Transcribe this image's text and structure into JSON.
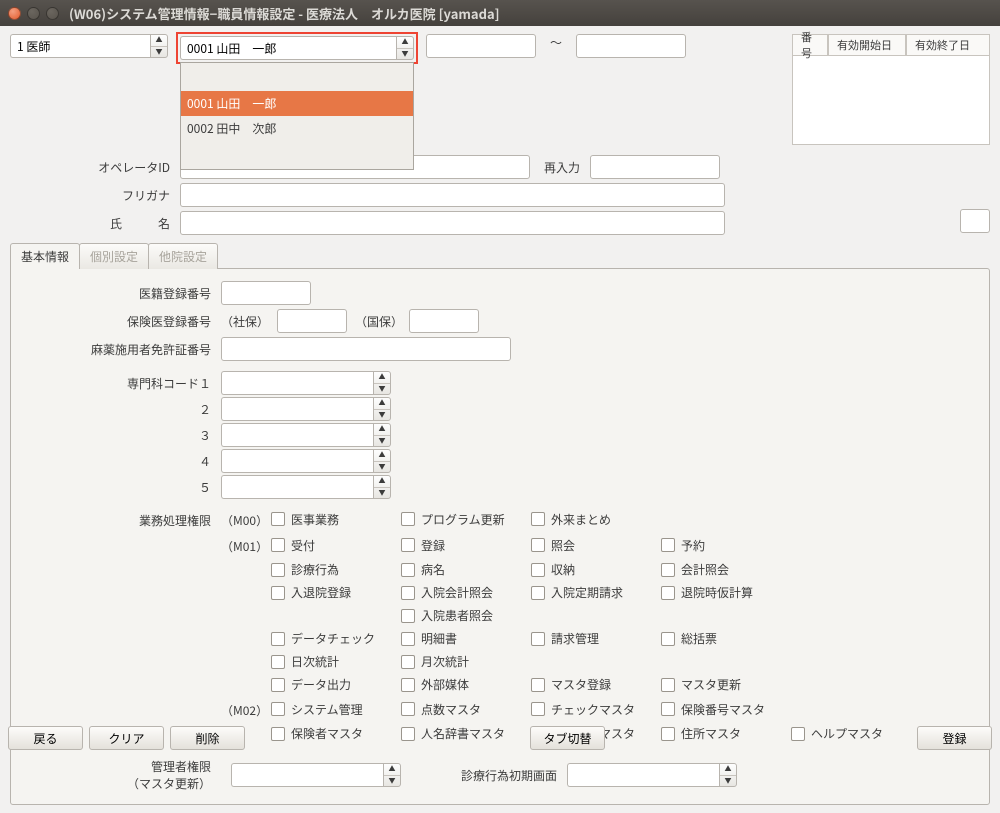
{
  "window_title": "(W06)システム管理情報−職員情報設定 - 医療法人　オルカ医院  [yamada]",
  "top": {
    "shokugyo": "1 医師",
    "staff_selected": "0001 山田　一郎",
    "staff_options": [
      "0001 山田　一郎",
      "0002 田中　次郎"
    ],
    "tilde": "～",
    "head_cols": {
      "num": "番号",
      "start": "有効開始日",
      "end": "有効終了日"
    }
  },
  "labels": {
    "operator_id": "オペレータID",
    "reentry": "再入力",
    "furigana": "フリガナ",
    "name": "氏　　　名"
  },
  "tabs": {
    "basic": "基本情報",
    "indiv": "個別設定",
    "other": "他院設定"
  },
  "basic": {
    "iseki": "医籍登録番号",
    "hoken": "保険医登録番号",
    "shaho": "（社保）",
    "kokuho": "（国保）",
    "mayaku": "麻薬施用者免許証番号",
    "senmon1": "専門科コード１",
    "n2": "２",
    "n3": "３",
    "n4": "４",
    "n5": "５",
    "gyomu": "業務処理権限",
    "m00": "（M00）",
    "m01": "（M01）",
    "m02": "（M02）",
    "perms": {
      "iji": "医事業務",
      "prog": "プログラム更新",
      "gairai": "外来まとめ",
      "uketsuke": "受付",
      "toroku": "登録",
      "shokai": "照会",
      "yoyaku": "予約",
      "shinryo": "診療行為",
      "byomei": "病名",
      "shuno": "収納",
      "kaikei": "会計照会",
      "nyutai": "入退院登録",
      "nkaikei": "入院会計照会",
      "nteiki": "入院定期請求",
      "taiin": "退院時仮計算",
      "nkanja": "入院患者照会",
      "datacheck": "データチェック",
      "meisai": "明細書",
      "seikyu": "請求管理",
      "sokatsu": "総括票",
      "nichiji": "日次統計",
      "getsuji": "月次統計",
      "dataout": "データ出力",
      "gaibu": "外部媒体",
      "mtoroku": "マスタ登録",
      "mkoshin": "マスタ更新",
      "sysadmin": "システム管理",
      "tensu": "点数マスタ",
      "check": "チェックマスタ",
      "hokennum": "保険番号マスタ",
      "hokensha": "保険者マスタ",
      "jinmei": "人名辞書マスタ",
      "yakuzai": "薬剤情報マスタ",
      "jusho": "住所マスタ",
      "help": "ヘルプマスタ"
    },
    "admin_priv": "管理者権限",
    "master_update": "（マスタ更新）",
    "shoki": "診療行為初期画面"
  },
  "footer": {
    "back": "戻る",
    "clear": "クリア",
    "delete": "削除",
    "tabswitch": "タブ切替",
    "register": "登録"
  }
}
